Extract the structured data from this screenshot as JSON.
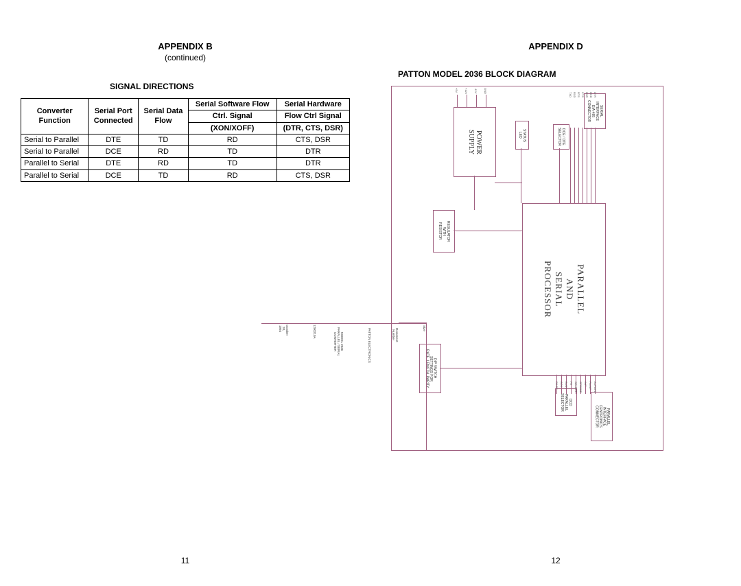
{
  "left": {
    "appendix": "APPENDIX B",
    "continued": "(continued)",
    "section": "SIGNAL DIRECTIONS",
    "headers": {
      "c1a": "Converter",
      "c1b": "Function",
      "c2a": "Serial Port",
      "c2b": "Connected",
      "c3a": "Serial Data",
      "c3b": "Flow",
      "c4a": "Serial Software Flow",
      "c4b": "Ctrl. Signal",
      "c4c": "(XON/XOFF)",
      "c5a": "Serial Hardware",
      "c5b": "Flow Ctrl Signal",
      "c5c": "(DTR, CTS, DSR)"
    },
    "rows": [
      {
        "fn": "Serial to Parallel",
        "port": "DTE",
        "data": "TD",
        "sw": "RD",
        "hw": "CTS, DSR"
      },
      {
        "fn": "Serial to Parallel",
        "port": "DCE",
        "data": "RD",
        "sw": "TD",
        "hw": "DTR"
      },
      {
        "fn": "Parallel to Serial",
        "port": "DTE",
        "data": "RD",
        "sw": "TD",
        "hw": "DTR"
      },
      {
        "fn": "Parallel to Serial",
        "port": "DCE",
        "data": "TD",
        "sw": "RD",
        "hw": "CTS, DSR"
      }
    ],
    "pagenum": "11"
  },
  "right": {
    "appendix": "APPENDIX D",
    "section": "PATTON MODEL 2036 BLOCK DIAGRAM",
    "pagenum": "12",
    "diagram": {
      "processor": "PARALLEL\nAND\nSERIAL\nPROCESSOR",
      "power": "POWER\nSUPPLY",
      "regulator": "REGULATOR\nWITH\nRESISTOR",
      "statusled": "STATUS\nLED",
      "dcedte": "DCE / DTE\nSELECTOR",
      "serialconn": "SERIAL\nINTERFACE\nEIA-485\nCONNECTOR",
      "parallelconn": "PARALLEL\nINTERFACE\nCENTRONICS\nCONNECTOR",
      "dcdparallel": "DCD\nPARALLEL\nSELECTOR",
      "dipswitch": "DIP SWITCH\nSETTINGS FOR\nRATE, LENGTH, PARITY",
      "titleblock": {
        "company": "PATTON ELECTRONICS",
        "product": "MODEL 2036 PARALLEL / SERIAL CONVERTER",
        "docnum": "1200210A",
        "size": "Document Number",
        "date": "October 20, 1994"
      },
      "wires_top_to_serial": [
        "TXD",
        "RXD",
        "RTS",
        "CTS",
        "DSR",
        "DCD",
        "DTR"
      ],
      "wires_bottom_parallel": [
        "D0-D7",
        "ACK",
        "BUSY",
        "PE",
        "SELECT",
        "STROBE",
        "INIT",
        "FAULT",
        "AUTOFD"
      ],
      "power_pins": [
        "+5V",
        "+12V",
        "-12V",
        "GND"
      ]
    }
  }
}
